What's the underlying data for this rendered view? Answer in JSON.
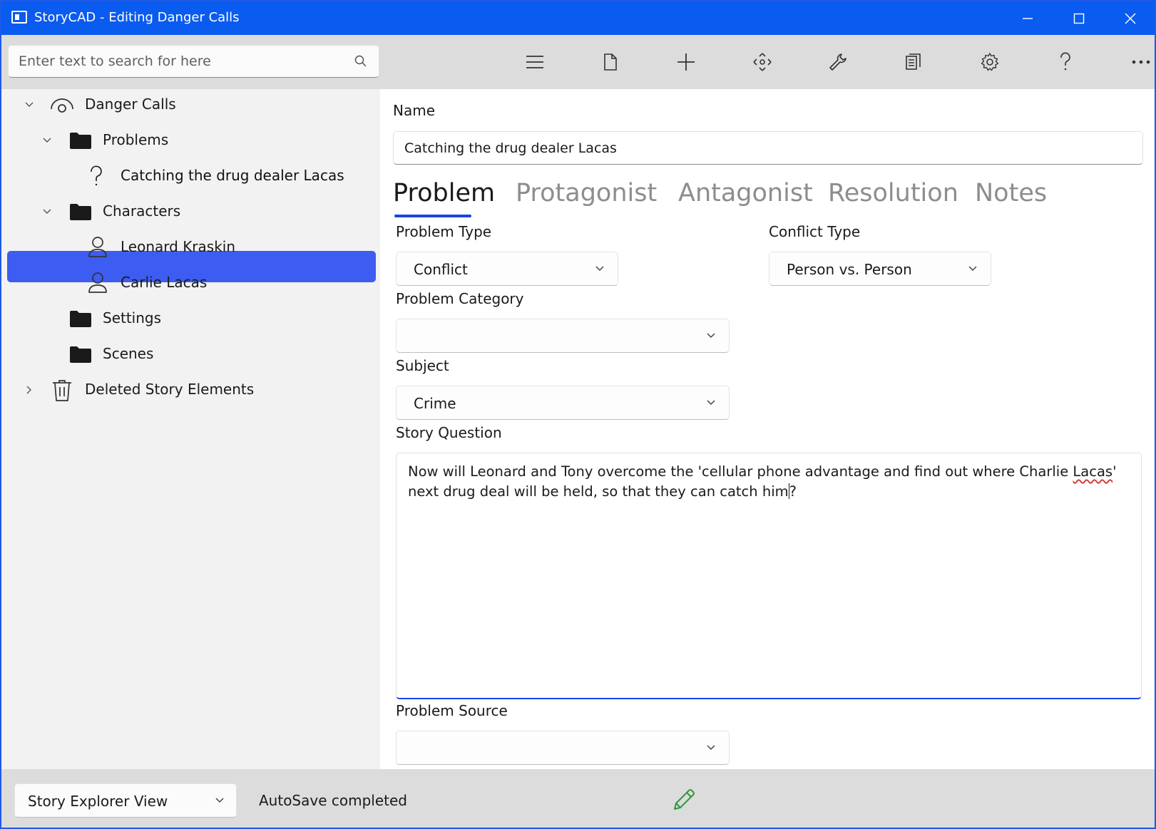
{
  "window": {
    "title": "StoryCAD - Editing Danger Calls"
  },
  "toolbar": {
    "search_placeholder": "Enter text to search for here",
    "buttons": [
      "menu-icon",
      "file-icon",
      "add-icon",
      "move-icon",
      "tools-icon",
      "report-icon",
      "settings-icon",
      "help-icon",
      "more-icon"
    ]
  },
  "tree": {
    "root": "Danger Calls",
    "problems": "Problems",
    "problem_item": "Catching the drug dealer Lacas",
    "characters": "Characters",
    "character_1": "Leonard Kraskin",
    "character_2": "Carlie Lacas",
    "settings": "Settings",
    "scenes": "Scenes",
    "trash": "Deleted Story Elements"
  },
  "form": {
    "name_label": "Name",
    "name_value": "Catching the drug dealer Lacas",
    "tabs": [
      "Problem",
      "Protagonist",
      "Antagonist",
      "Resolution",
      "Notes"
    ],
    "problem_type_label": "Problem Type",
    "problem_type_value": "Conflict",
    "conflict_type_label": "Conflict Type",
    "conflict_type_value": "Person vs. Person",
    "problem_category_label": "Problem Category",
    "problem_category_value": "",
    "subject_label": "Subject",
    "subject_value": "Crime",
    "story_question_label": "Story Question",
    "story_question_part1": "Now will Leonard and Tony overcome the 'cellular phone advantage and find out where Charlie ",
    "story_question_misspelled": "Lacas",
    "story_question_part2": "' next drug deal will be held, so that they can catch him",
    "story_question_part3": "?",
    "problem_source_label": "Problem Source",
    "problem_source_value": ""
  },
  "status": {
    "view_value": "Story Explorer View",
    "message": "AutoSave completed"
  },
  "colors": {
    "titlebar": "#0a5bef",
    "selection": "#3d5cf2",
    "accent": "#1845e0",
    "edit_icon": "#2e9a3a"
  }
}
